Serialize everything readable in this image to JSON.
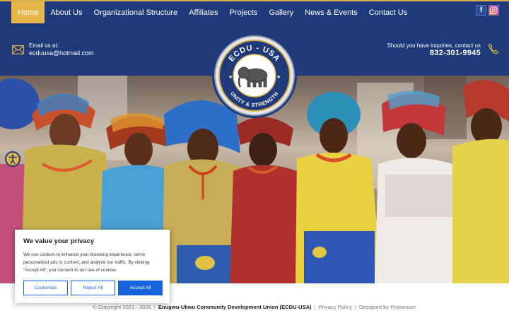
{
  "nav": {
    "items": [
      {
        "label": "Home",
        "active": true
      },
      {
        "label": "About Us"
      },
      {
        "label": "Organizational Structure"
      },
      {
        "label": "Affiliates"
      },
      {
        "label": "Projects"
      },
      {
        "label": "Gallery"
      },
      {
        "label": "News & Events"
      },
      {
        "label": "Contact Us"
      }
    ],
    "social": [
      {
        "icon": "facebook-icon",
        "glyph": "f"
      },
      {
        "icon": "instagram-icon"
      }
    ]
  },
  "header": {
    "email_label": "Email us at:",
    "email": "ecduusa@hotmail.com",
    "inquiry_label": "Should you have inquiries, contact us",
    "phone": "832-301-9945"
  },
  "logo": {
    "top_text": "ECDU - USA",
    "bottom_text": "UNITY & STRENGTH"
  },
  "cookie": {
    "title": "We value your privacy",
    "body": "We use cookies to enhance your browsing experience, serve personalized ads or content, and analyze our traffic. By clicking \"Accept All\", you consent to our use of cookies.",
    "customize": "Customize",
    "reject": "Reject All",
    "accept": "Accept All"
  },
  "footer": {
    "copyright": "© Copyright 2021 - 2026",
    "org": "Enugwu-Ukwu Community Development Union (ECDU-USA)",
    "privacy": "Privacy Policy",
    "designed": "Designed by Proweaver"
  },
  "colors": {
    "navy": "#1f3a7a",
    "gold": "#e5b64a",
    "accept_blue": "#1863dc"
  }
}
